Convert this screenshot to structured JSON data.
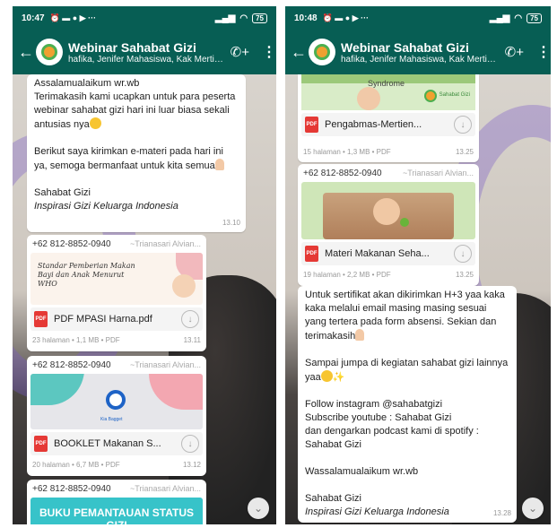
{
  "left": {
    "status": {
      "time": "10:47",
      "icons": "⏰ ▬ ● ▶ ···",
      "battery": "75"
    },
    "header": {
      "title": "Webinar Sahabat Gizi",
      "participants": "hafika, Jenifer Mahasiswa, Kak Mertie..."
    },
    "message1": {
      "greeting": "Assalamualaikum wr.wb",
      "para1": "Terimakasih kami ucapkan untuk para peserta webinar sahabat gizi hari ini luar biasa sekali antusias nya",
      "para2": "Berikut saya kirimkan e-materi pada hari ini ya, semoga bermanfaat untuk kita semua",
      "sign1": "Sahabat Gizi",
      "sign2": "Inspirasi Gizi Keluarga Indonesia",
      "time": "13.10"
    },
    "doc1": {
      "sender": "+62 812-8852-0940",
      "alias": "~Trianasari Alvian...",
      "thumb_text": "Standar Pemberian Makan Bayi dan Anak Menurut WHO",
      "name": "PDF  MPASI Harna.pdf",
      "meta": "23 halaman • 1,1 MB • PDF",
      "time": "13.11"
    },
    "doc2": {
      "sender": "+62 812-8852-0940",
      "alias": "~Trianasari Alvian...",
      "thumb_text": "Kia Bagget",
      "name": "BOOKLET Makanan S...",
      "meta": "20 halaman • 6,7 MB • PDF",
      "time": "13.12"
    },
    "doc3": {
      "sender": "+62 812-8852-0940",
      "alias": "~Trianasari Alvian...",
      "thumb_text": "BUKU PEMANTAUAN STATUS GIZI"
    }
  },
  "right": {
    "status": {
      "time": "10:48",
      "icons": "⏰ ▬ ● ▶ ···",
      "battery": "75"
    },
    "header": {
      "title": "Webinar Sahabat Gizi",
      "participants": "hafika, Jenifer Mahasiswa, Kak Mertie..."
    },
    "doc_a": {
      "thumb_text": "Syndrome",
      "logo_text": "Sahabat Gizi",
      "name": "Pengabmas-Mertien...",
      "meta": "15 halaman • 1,3 MB • PDF",
      "time": "13.25"
    },
    "doc_b": {
      "sender": "+62 812-8852-0940",
      "alias": "~Trianasari Alvian...",
      "name": "Materi Makanan Seha...",
      "meta": "19 halaman • 2,2 MB • PDF",
      "time": "13.25"
    },
    "message2": {
      "para1": "Untuk sertifikat akan dikirimkan H+3 yaa kaka kaka melalui email masing masing sesuai yang tertera pada form absensi. Sekian dan terimakasih",
      "para2": "Sampai jumpa di kegiatan sahabat gizi lainnya yaa",
      "follow1": "Follow instagram @sahabatgizi",
      "follow2": "Subscribe youtube : Sahabat Gizi",
      "follow3": "dan dengarkan podcast kami di spotify : Sahabat Gizi",
      "closing": "Wassalamualaikum wr.wb",
      "sign1": "Sahabat Gizi",
      "sign2": "Inspirasi Gizi Keluarga Indonesia",
      "time": "13.28"
    }
  },
  "colors": {
    "header": "#075e54",
    "pdf": "#e53935",
    "bubble": "#ffffff"
  },
  "icons": {
    "back": "arrow-left-icon",
    "call": "add-call-icon",
    "menu": "more-vert-icon",
    "scroll": "chevron-down-icon",
    "download": "download-icon"
  }
}
